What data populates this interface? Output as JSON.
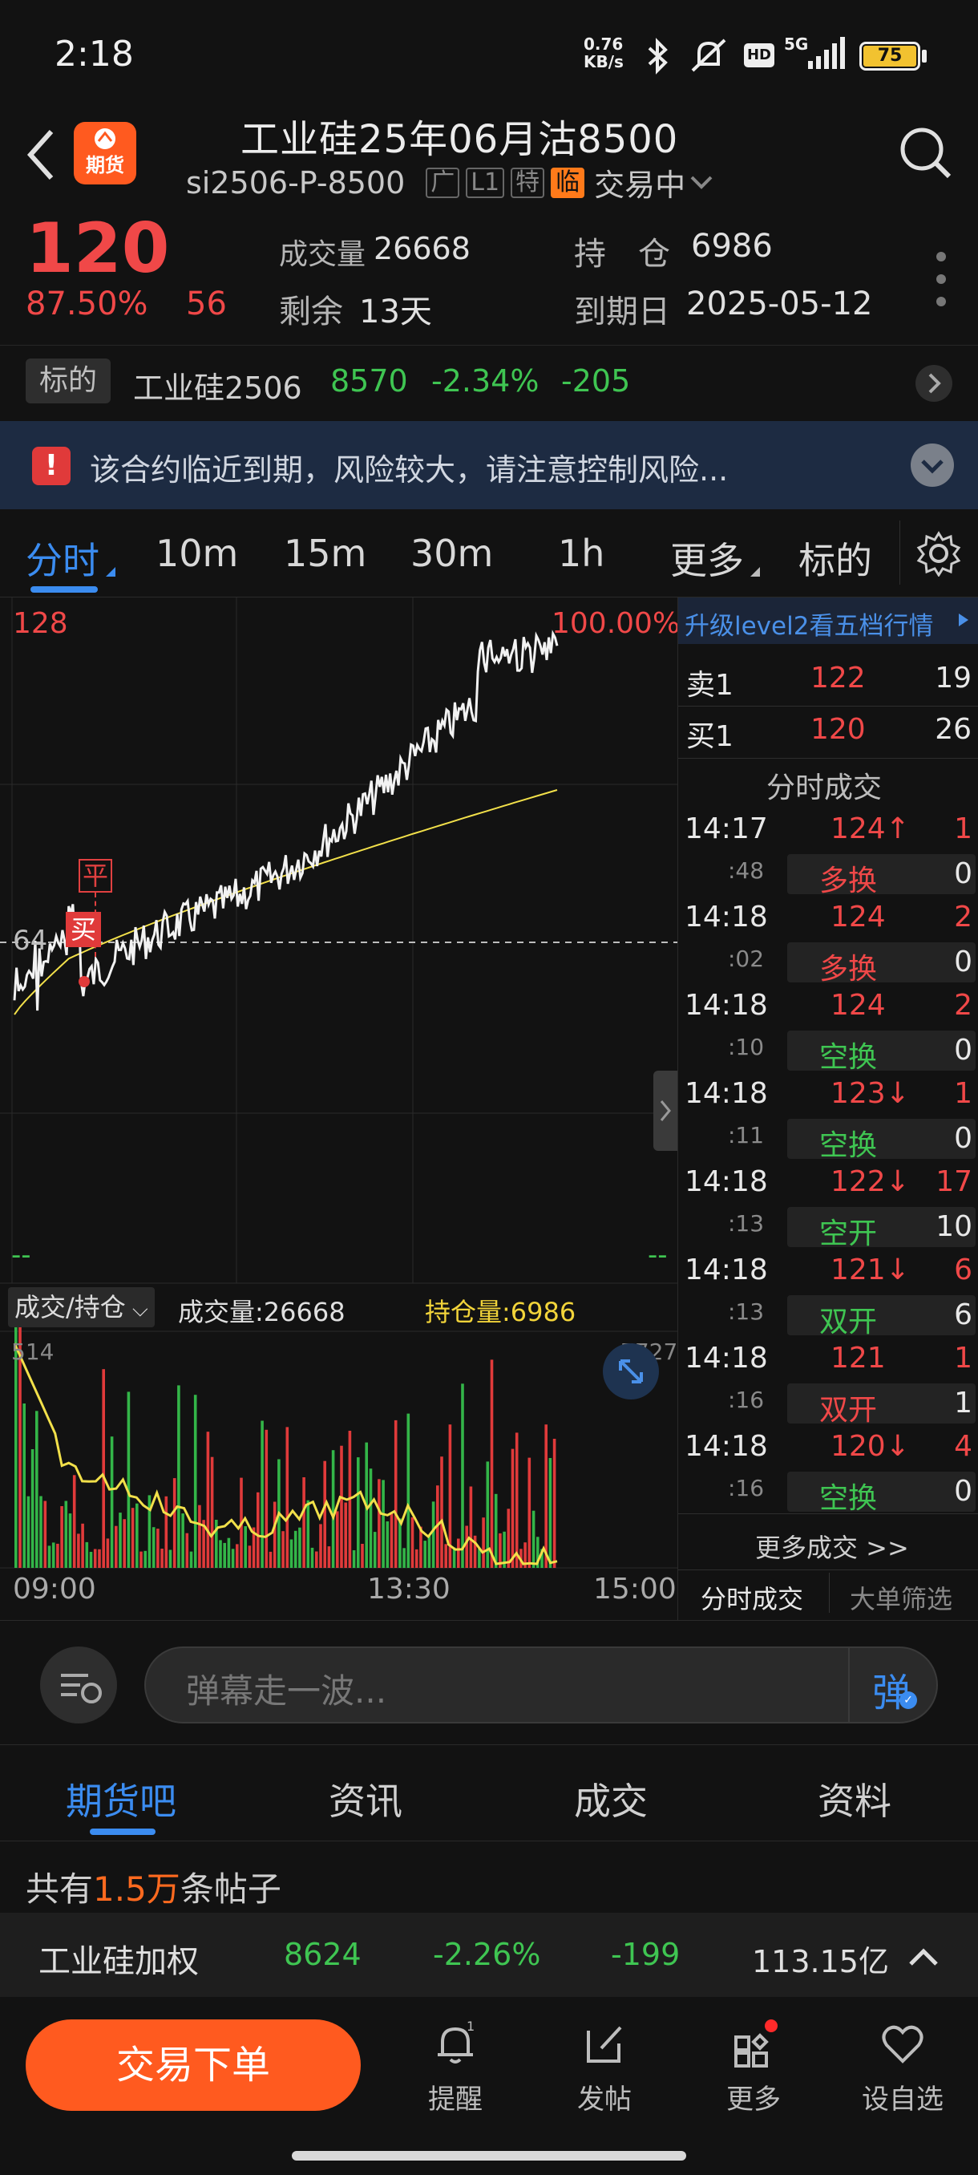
{
  "status": {
    "time": "2:18",
    "speed": "0.76\nKB/s",
    "battery": "75"
  },
  "header": {
    "title": "工业硅25年06月沽8500",
    "code": "si2506-P-8500",
    "badge": "期货",
    "tags": [
      "广",
      "L1",
      "特",
      "临"
    ],
    "trade_status": "交易中"
  },
  "quote": {
    "price": "120",
    "change_pct": "87.50%",
    "change": "56",
    "volume_label": "成交量",
    "volume": "26668",
    "oi_label": "持　仓",
    "oi": "6986",
    "remain_label": "剩余",
    "remain": "13天",
    "expiry_label": "到期日",
    "expiry": "2025-05-12"
  },
  "underlying": {
    "tag": "标的",
    "name": "工业硅2506",
    "price": "8570",
    "pct": "-2.34%",
    "chg": "-205"
  },
  "warning": {
    "text": "该合约临近到期，风险较大，请注意控制风险..."
  },
  "chart_tabs": [
    "分时",
    "10m",
    "15m",
    "30m",
    "1h",
    "更多",
    "标的"
  ],
  "chart": {
    "y_top": "128",
    "y_top_pct": "100.00%",
    "y_mid": "64",
    "mark_buy": "买",
    "mark_close": "平",
    "dash_left": "--",
    "dash_right": "--",
    "vol_selector": "成交/持仓",
    "vol_label": "成交量:26668",
    "oi_label": "持仓量:6986",
    "vol_max": "514",
    "oi_max": "7727",
    "x_labels": [
      "09:00",
      "13:30",
      "15:00"
    ]
  },
  "side": {
    "upgrade": "升级level2看五档行情",
    "ask_label": "卖1",
    "ask_price": "122",
    "ask_vol": "19",
    "bid_label": "买1",
    "bid_price": "120",
    "bid_vol": "26",
    "section": "分时成交",
    "trades": [
      {
        "time": "14:17",
        "sec": ":48",
        "price": "124↑",
        "vol": "1",
        "type": "多换",
        "oi": "0",
        "pc": "red",
        "tc": "red"
      },
      {
        "time": "14:18",
        "sec": ":02",
        "price": "124",
        "vol": "2",
        "type": "多换",
        "oi": "0",
        "pc": "red",
        "tc": "red"
      },
      {
        "time": "14:18",
        "sec": ":10",
        "price": "124",
        "vol": "2",
        "type": "空换",
        "oi": "0",
        "pc": "red",
        "tc": "green"
      },
      {
        "time": "14:18",
        "sec": ":11",
        "price": "123↓",
        "vol": "1",
        "type": "空换",
        "oi": "0",
        "pc": "red",
        "tc": "green"
      },
      {
        "time": "14:18",
        "sec": ":13",
        "price": "122↓",
        "vol": "17",
        "type": "空开",
        "oi": "10",
        "pc": "red",
        "tc": "green"
      },
      {
        "time": "14:18",
        "sec": ":13",
        "price": "121↓",
        "vol": "6",
        "type": "双开",
        "oi": "6",
        "pc": "red",
        "tc": "green"
      },
      {
        "time": "14:18",
        "sec": ":16",
        "price": "121",
        "vol": "1",
        "type": "双开",
        "oi": "1",
        "pc": "red",
        "tc": "red"
      },
      {
        "time": "14:18",
        "sec": ":16",
        "price": "120↓",
        "vol": "4",
        "type": "空换",
        "oi": "0",
        "pc": "red",
        "tc": "green"
      }
    ],
    "more": "更多成交 >>",
    "tab_active": "分时成交",
    "tab_other": "大单筛选"
  },
  "danmu": {
    "placeholder": "弹幕走一波...",
    "send": "弹"
  },
  "bottom_tabs": [
    "期货吧",
    "资讯",
    "成交",
    "资料"
  ],
  "posts": {
    "prefix": "共有",
    "count": "1.5万",
    "suffix": "条帖子"
  },
  "ticker": {
    "name": "工业硅加权",
    "price": "8624",
    "pct": "-2.26%",
    "chg": "-199",
    "amount": "113.15亿"
  },
  "actions": {
    "trade": "交易下单",
    "remind": "提醒",
    "post": "发帖",
    "more": "更多",
    "watch": "设自选"
  }
}
